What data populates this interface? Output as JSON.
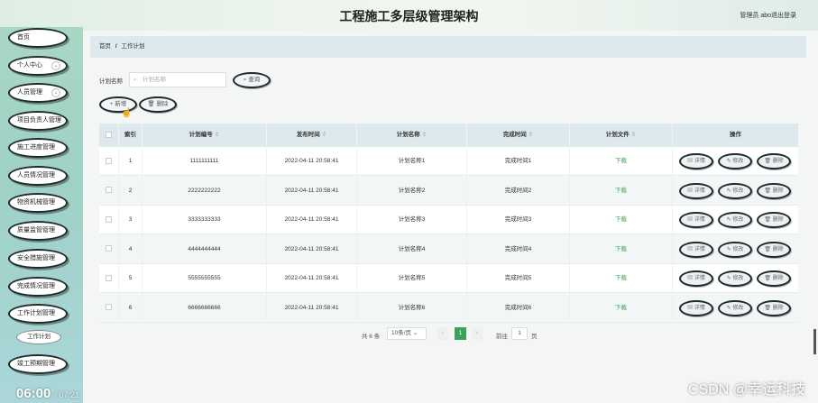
{
  "header": {
    "title": "工程施工多层级管理架构",
    "user": "管理员 abo",
    "logout": "退出登录"
  },
  "sidebar": {
    "items": [
      {
        "label": "首页"
      },
      {
        "label": "个人中心"
      },
      {
        "label": "人员管理"
      },
      {
        "label": "项目负责人管理"
      },
      {
        "label": "施工进度管理"
      },
      {
        "label": "人员情况管理"
      },
      {
        "label": "物资机械管理"
      },
      {
        "label": "质量监管管理"
      },
      {
        "label": "安全措施管理"
      },
      {
        "label": "完成情况管理"
      },
      {
        "label": "工作计划管理"
      },
      {
        "label": "竣工预期管理"
      }
    ],
    "sub_item": "工作计划"
  },
  "video": {
    "time": "06:00",
    "duration": "/ 07:21"
  },
  "breadcrumb": {
    "home": "首页",
    "sep": "/",
    "current": "工作计划"
  },
  "search": {
    "label": "计划名称",
    "placeholder": "计划名称",
    "button": "查询"
  },
  "toolbar": {
    "add": "+ 新增",
    "delete": "删除"
  },
  "table": {
    "columns": [
      "索引",
      "计划编号",
      "发布时间",
      "计划名称",
      "完成时间",
      "计划文件",
      "操作"
    ],
    "rows": [
      {
        "index": "1",
        "code": "1111111111",
        "time": "2022-04-11 20:58:41",
        "name": "计划名称1",
        "done": "完成时间1",
        "file": "下载"
      },
      {
        "index": "2",
        "code": "2222222222",
        "time": "2022-04-11 20:58:41",
        "name": "计划名称2",
        "done": "完成时间2",
        "file": "下载"
      },
      {
        "index": "3",
        "code": "3333333333",
        "time": "2022-04-11 20:58:41",
        "name": "计划名称3",
        "done": "完成时间3",
        "file": "下载"
      },
      {
        "index": "4",
        "code": "4444444444",
        "time": "2022-04-11 20:58:41",
        "name": "计划名称4",
        "done": "完成时间4",
        "file": "下载"
      },
      {
        "index": "5",
        "code": "5555555555",
        "time": "2022-04-11 20:58:41",
        "name": "计划名称5",
        "done": "完成时间5",
        "file": "下载"
      },
      {
        "index": "6",
        "code": "6666666666",
        "time": "2022-04-11 20:58:41",
        "name": "计划名称6",
        "done": "完成时间6",
        "file": "下载"
      }
    ],
    "actions": {
      "detail": "详情",
      "edit": "修改",
      "delete": "删除"
    }
  },
  "pagination": {
    "total": "共 6 条",
    "page_size": "10条/页",
    "current": "1",
    "goto": "前往",
    "goto_value": "1",
    "page_unit": "页"
  },
  "watermark": "CSDN @幸运科技",
  "colors": {
    "accent": "#3aa35a",
    "header_row": "#dde9ec"
  }
}
